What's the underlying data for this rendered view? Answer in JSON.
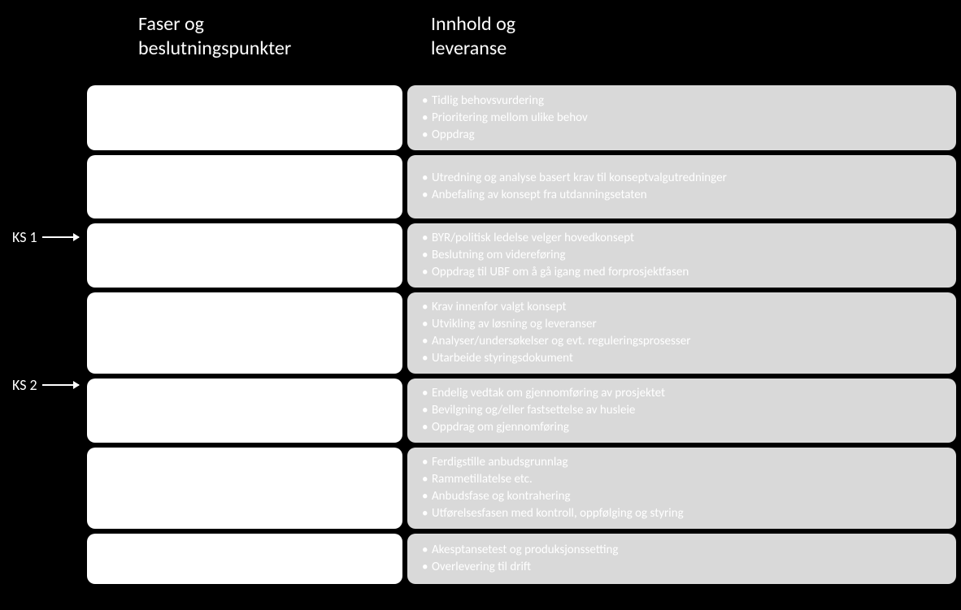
{
  "headers": {
    "left_line1": "Faser og",
    "left_line2": "beslutningspunkter",
    "right_line1": "Innhold og",
    "right_line2": "leveranse"
  },
  "markers": {
    "ks1": "KS 1",
    "ks2": "KS 2"
  },
  "rows": [
    {
      "items": [
        "Tidlig behovsvurdering",
        "Prioritering mellom ulike behov",
        "Oppdrag"
      ]
    },
    {
      "items": [
        "Utredning og analyse basert krav til konseptvalgutredninger",
        "Anbefaling av konsept fra utdanningsetaten"
      ]
    },
    {
      "items": [
        "BYR/politisk ledelse velger hovedkonsept",
        "Beslutning om videreføring",
        "Oppdrag til UBF om å gå igang med forprosjektfasen"
      ]
    },
    {
      "items": [
        "Krav innenfor valgt konsept",
        "Utvikling av løsning og leveranser",
        "Analyser/undersøkelser og evt. reguleringsprosesser",
        "Utarbeide styringsdokument"
      ]
    },
    {
      "items": [
        "Endelig vedtak om gjennomføring av prosjektet",
        "Bevilgning og/eller fastsettelse av husleie",
        "Oppdrag om gjennomføring"
      ]
    },
    {
      "items": [
        "Ferdigstille anbudsgrunnlag",
        "Rammetillatelse etc.",
        "Anbudsfase og kontrahering",
        "Utførelsesfasen med kontroll, oppfølging og styring"
      ]
    },
    {
      "items": [
        "Akesptansetest og produksjonssetting",
        "Overlevering til drift"
      ]
    }
  ]
}
